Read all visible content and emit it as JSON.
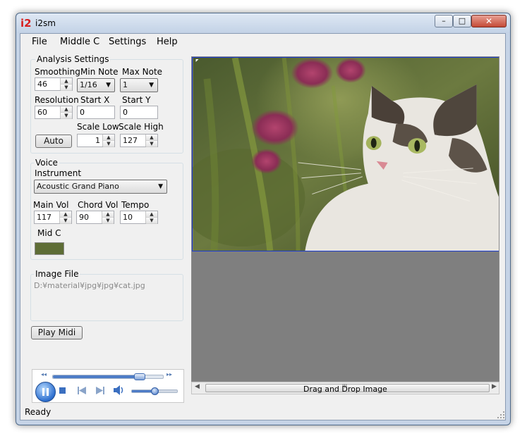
{
  "window": {
    "logo": "i2",
    "title": "i2sm"
  },
  "controls": {
    "minimize": "–",
    "maximize": "□",
    "close": "✕"
  },
  "menu": [
    "File",
    "Middle C",
    "Settings",
    "Help"
  ],
  "analysis": {
    "group_label": "Analysis Settings",
    "smoothing": {
      "label": "Smoothing",
      "value": "46"
    },
    "min_note": {
      "label": "Min Note",
      "value": "1/16"
    },
    "max_note": {
      "label": "Max Note",
      "value": "1"
    },
    "resolution": {
      "label": "Resolution",
      "value": "60"
    },
    "start_x": {
      "label": "Start X",
      "value": "0"
    },
    "start_y": {
      "label": "Start Y",
      "value": "0"
    },
    "scale_low": {
      "label": "Scale Low",
      "value": "1"
    },
    "scale_high": {
      "label": "Scale High",
      "value": "127"
    },
    "auto_button": "Auto"
  },
  "voice": {
    "group_label": "Voice",
    "instrument_label": "Instrument",
    "instrument_value": "Acoustic Grand Piano",
    "main_vol": {
      "label": "Main Vol",
      "value": "117"
    },
    "chord_vol": {
      "label": "Chord Vol",
      "value": "90"
    },
    "tempo": {
      "label": "Tempo",
      "value": "10"
    },
    "mid_c_label": "Mid C",
    "mid_c_color": "#5e6d36"
  },
  "image_file": {
    "group_label": "Image File",
    "path": "D:¥material¥jpg¥jpg¥cat.jpg"
  },
  "play_button": "Play Midi",
  "media_player": {
    "seek_progress": 0.78,
    "volume_level": 0.5,
    "rewind_icon": "◂◂",
    "forward_icon": "▸▸"
  },
  "image_view": {
    "drop_label": "Drag and Drop Image",
    "scroll_grip": "III"
  },
  "status": "Ready"
}
